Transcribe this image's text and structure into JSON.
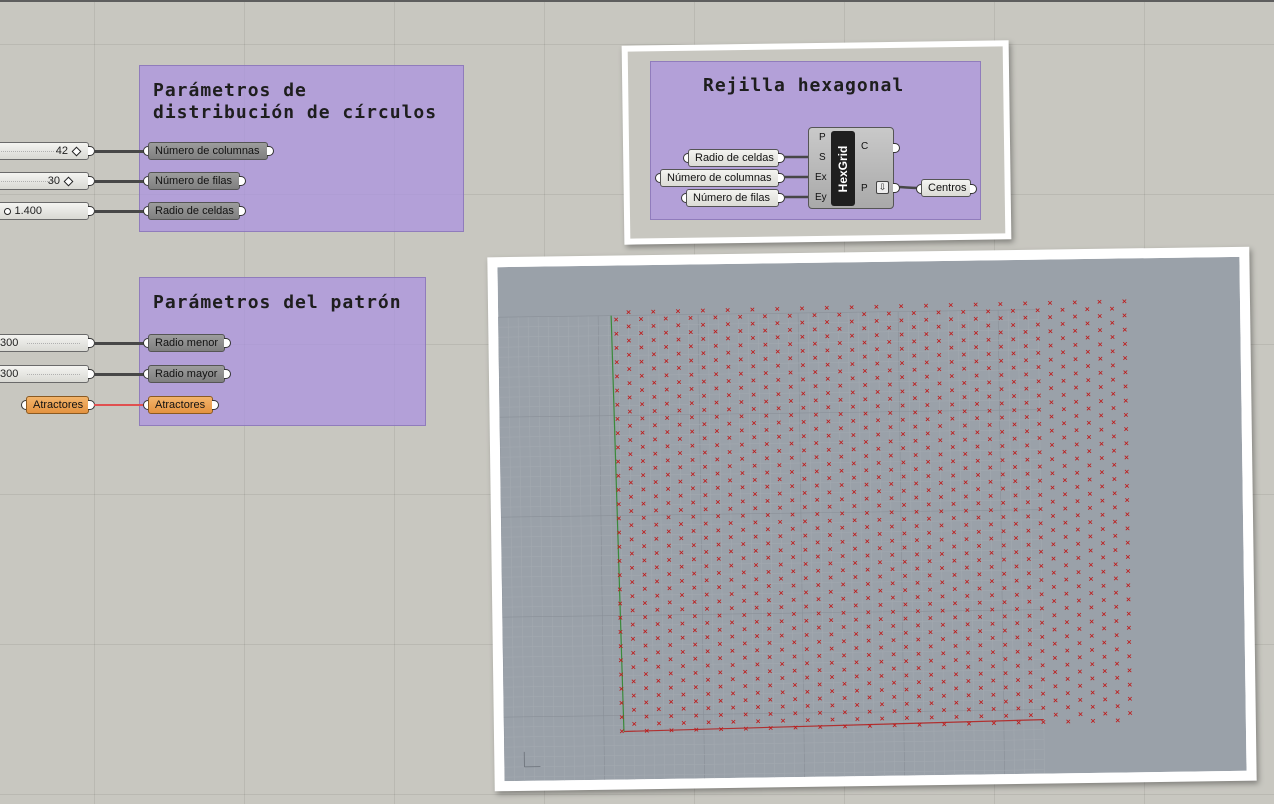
{
  "groups": {
    "distribution": {
      "title": "Parámetros de\ndistribución de círculos"
    },
    "pattern": {
      "title": "Parámetros del patrón"
    },
    "hexgrid": {
      "title": "Rejilla hexagonal"
    }
  },
  "sliders": {
    "columns_value": "42",
    "rows_value": "30",
    "cell_radius_value": "1.400",
    "minor_radius_value": "300",
    "major_radius_value": "300"
  },
  "params": {
    "columns": "Número de columnas",
    "rows": "Número de filas",
    "cell_radius": "Radio de celdas",
    "minor_radius": "Radio menor",
    "major_radius": "Radio mayor",
    "attractors_source": "Atractores",
    "attractors": "Atractores"
  },
  "hexgrid_component": {
    "name": "HexGrid",
    "inputs": [
      "P",
      "S",
      "Ex",
      "Ey"
    ],
    "outputs": [
      "C",
      "P"
    ],
    "output_param": "Centros"
  },
  "viewport": {
    "point_color": "#c01818",
    "background": "#9aa1a9",
    "grid_columns": 42,
    "grid_rows": 30
  },
  "colors": {
    "group_fill": "#aa91e1",
    "wire": "#474747",
    "attractor_wire": "#e05050",
    "attractor_param": "#e49340"
  }
}
